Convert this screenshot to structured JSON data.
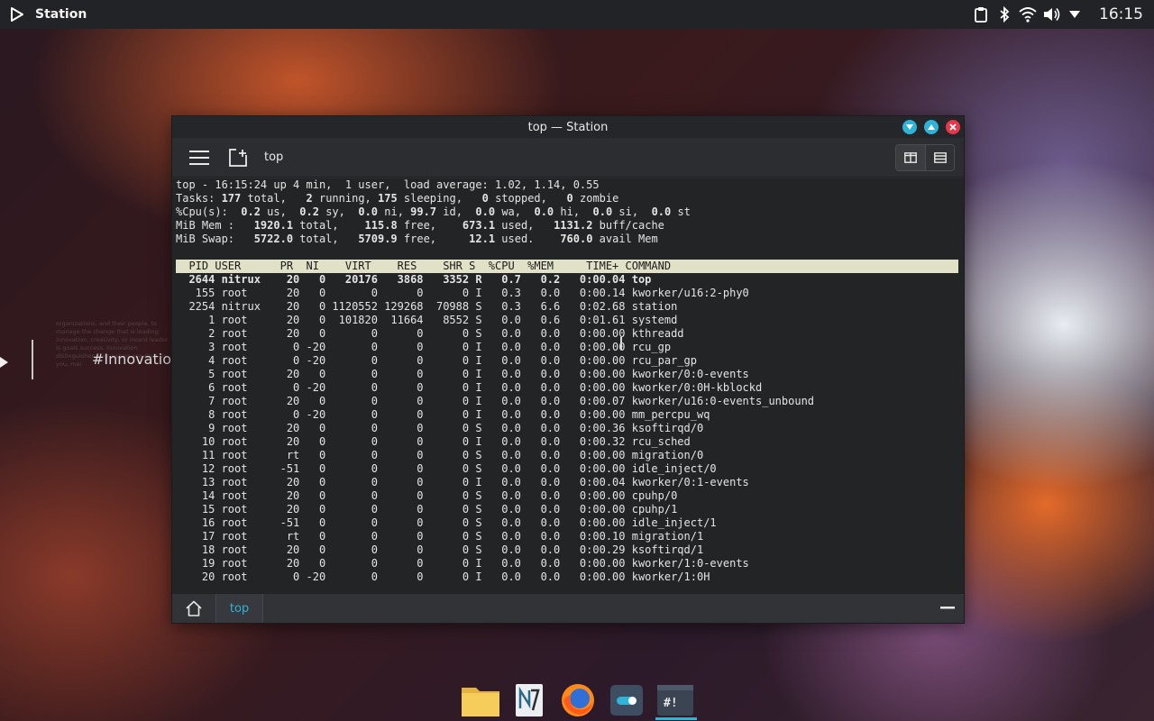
{
  "top_panel": {
    "app_title": "Station",
    "clock": "16:15",
    "tray_icons": [
      "clipboard-icon",
      "bluetooth-icon",
      "wifi-icon",
      "volume-icon",
      "dropdown-arrow-icon"
    ]
  },
  "desktop_widget": {
    "tag": "#Innovation",
    "faint_text": "organizations, and their people, to manage the change that is leading innovation, creativity, or incent leader is goals success. Innovation distinguishes your values are clear to you, mai"
  },
  "window": {
    "title": "top — Station",
    "tab_title": "top",
    "status_tab": "top",
    "colors": {
      "accent": "#2fb3d6",
      "close": "#e4394d",
      "terminal_bg": "#232426",
      "header_bg": "#e1e1c8"
    }
  },
  "terminal": {
    "summary": {
      "line1": "top - 16:15:24 up 4 min,  1 user,  load average: 1.02, 1.14, 0.55",
      "tasks_label": "Tasks: ",
      "tasks_total": "177",
      "tasks_total_lbl": " total,   ",
      "tasks_running": "2",
      "tasks_running_lbl": " running, ",
      "tasks_sleeping": "175",
      "tasks_sleeping_lbl": " sleeping,   ",
      "tasks_stopped": "0",
      "tasks_stopped_lbl": " stopped,   ",
      "tasks_zombie": "0",
      "tasks_zombie_lbl": " zombie",
      "cpu_label": "%Cpu(s):  ",
      "cpu_us": "0.2",
      "cpu_us_lbl": " us,  ",
      "cpu_sy": "0.2",
      "cpu_sy_lbl": " sy,  ",
      "cpu_ni": "0.0",
      "cpu_ni_lbl": " ni, ",
      "cpu_id": "99.7",
      "cpu_id_lbl": " id,  ",
      "cpu_wa": "0.0",
      "cpu_wa_lbl": " wa,  ",
      "cpu_hi": "0.0",
      "cpu_hi_lbl": " hi,  ",
      "cpu_si": "0.0",
      "cpu_si_lbl": " si,  ",
      "cpu_st": "0.0",
      "cpu_st_lbl": " st",
      "mem_label": "MiB Mem :   ",
      "mem_total": "1920.1",
      "mem_total_lbl": " total,    ",
      "mem_free": "115.8",
      "mem_free_lbl": " free,    ",
      "mem_used": "673.1",
      "mem_used_lbl": " used,   ",
      "mem_buff": "1131.2",
      "mem_buff_lbl": " buff/cache",
      "swap_label": "MiB Swap:   ",
      "swap_total": "5722.0",
      "swap_total_lbl": " total,   ",
      "swap_free": "5709.9",
      "swap_free_lbl": " free,     ",
      "swap_used": "12.1",
      "swap_used_lbl": " used.    ",
      "swap_avail": "760.0",
      "swap_avail_lbl": " avail Mem"
    },
    "header": "  PID USER      PR  NI    VIRT    RES    SHR S  %CPU  %MEM     TIME+ COMMAND",
    "processes": [
      "  2644 nitrux    20   0   20176   3868   3352 R   0.7   0.2   0:00.04 top",
      "   155 root      20   0       0      0      0 I   0.3   0.0   0:00.14 kworker/u16:2-phy0",
      "  2254 nitrux    20   0 1120552 129268  70988 S   0.3   6.6   0:02.68 station",
      "     1 root      20   0  101820  11664   8552 S   0.0   0.6   0:01.61 systemd",
      "     2 root      20   0       0      0      0 S   0.0   0.0   0:00.00 kthreadd",
      "     3 root       0 -20       0      0      0 I   0.0   0.0   0:00.00 rcu_gp",
      "     4 root       0 -20       0      0      0 I   0.0   0.0   0:00.00 rcu_par_gp",
      "     5 root      20   0       0      0      0 I   0.0   0.0   0:00.00 kworker/0:0-events",
      "     6 root       0 -20       0      0      0 I   0.0   0.0   0:00.00 kworker/0:0H-kblockd",
      "     7 root      20   0       0      0      0 I   0.0   0.0   0:00.07 kworker/u16:0-events_unbound",
      "     8 root       0 -20       0      0      0 I   0.0   0.0   0:00.00 mm_percpu_wq",
      "     9 root      20   0       0      0      0 S   0.0   0.0   0:00.36 ksoftirqd/0",
      "    10 root      20   0       0      0      0 I   0.0   0.0   0:00.32 rcu_sched",
      "    11 root      rt   0       0      0      0 S   0.0   0.0   0:00.00 migration/0",
      "    12 root     -51   0       0      0      0 S   0.0   0.0   0:00.00 idle_inject/0",
      "    13 root      20   0       0      0      0 I   0.0   0.0   0:00.04 kworker/0:1-events",
      "    14 root      20   0       0      0      0 S   0.0   0.0   0:00.00 cpuhp/0",
      "    15 root      20   0       0      0      0 S   0.0   0.0   0:00.00 cpuhp/1",
      "    16 root     -51   0       0      0      0 S   0.0   0.0   0:00.00 idle_inject/1",
      "    17 root      rt   0       0      0      0 S   0.0   0.0   0:00.10 migration/1",
      "    18 root      20   0       0      0      0 S   0.0   0.0   0:00.29 ksoftirqd/1",
      "    19 root      20   0       0      0      0 I   0.0   0.0   0:00.00 kworker/1:0-events",
      "    20 root       0 -20       0      0      0 I   0.0   0.0   0:00.00 kworker/1:0H"
    ]
  },
  "dock": {
    "items": [
      {
        "name": "files-icon"
      },
      {
        "name": "notes-icon",
        "label": "N"
      },
      {
        "name": "firefox-icon"
      },
      {
        "name": "settings-toggle-icon"
      },
      {
        "name": "station-terminal-icon",
        "label": "#!"
      }
    ]
  }
}
